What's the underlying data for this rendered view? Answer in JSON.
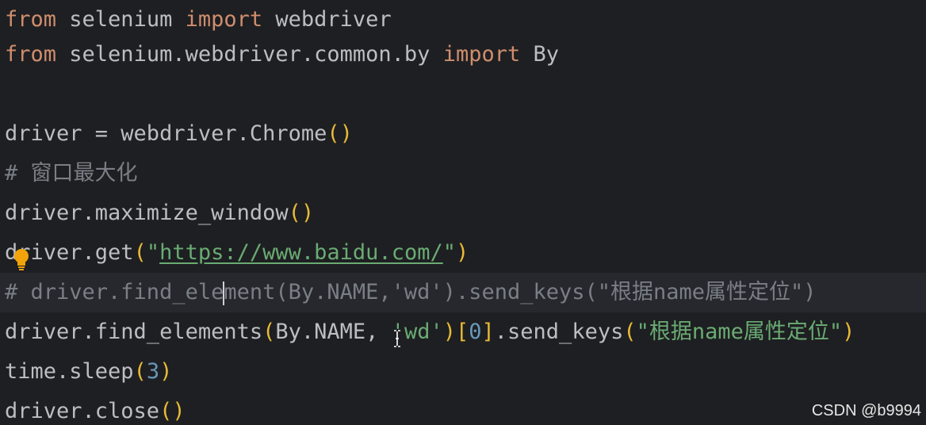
{
  "code": {
    "line1": {
      "kw1": "from",
      "mod": " selenium ",
      "kw2": "import",
      "name": " webdriver"
    },
    "line2": {
      "kw1": "from",
      "mod": " selenium.webdriver.common.by ",
      "kw2": "import",
      "name": " By"
    },
    "line4": {
      "lhs": "driver = webdriver.Chrome",
      "open": "(",
      "close": ")"
    },
    "line5": {
      "comment": "# 窗口最大化"
    },
    "line6": {
      "call": "driver.maximize_window",
      "open": "(",
      "close": ")"
    },
    "line7": {
      "call": "driver.get",
      "open": "(",
      "str_open": "\"",
      "url": "https://www.baidu.com/",
      "str_close": "\"",
      "close": ")"
    },
    "line8": {
      "comment_a": "# driver.find_ele",
      "comment_b": "ment(By.NAME,'wd').send_keys(\"根据name属性定位\")"
    },
    "line9": {
      "call": "driver.find_elements",
      "open": "(",
      "arg1": "By.NAME",
      "comma": ", ",
      "arg2": "'wd'",
      "close": ")",
      "idx_open": "[",
      "idx": "0",
      "idx_close": "]",
      "method": ".send_keys",
      "open2": "(",
      "arg3": "\"根据name属性定位\"",
      "close2": ")"
    },
    "line10": {
      "call": "time.sleep",
      "open": "(",
      "num": "3",
      "close": ")"
    },
    "line11": {
      "call": "driver.close",
      "open": "(",
      "close": ")"
    }
  },
  "watermark": "CSDN @b9994",
  "icons": {
    "intention": "lightbulb-icon",
    "cursor": "text-cursor-icon"
  },
  "colors": {
    "background": "#1e1f22",
    "keyword": "#cf8e6d",
    "bracket": "#e8ba36",
    "string": "#6aab73",
    "number": "#2aacb8",
    "comment": "#7a7e85",
    "text": "#bcbec4"
  }
}
